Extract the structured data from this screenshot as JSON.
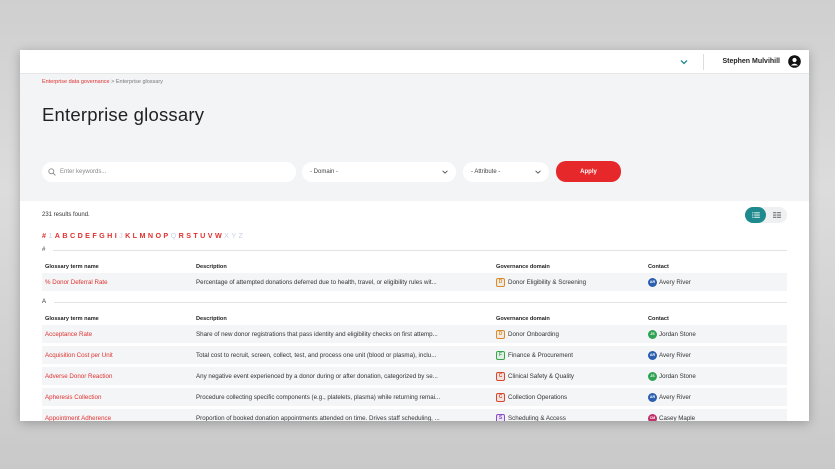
{
  "topbar": {
    "user_name": "Stephen Mulvihill"
  },
  "breadcrumb": {
    "parent": "Enterprise data governance",
    "separator": ">",
    "current": "Enterprise glossary"
  },
  "page_title": "Enterprise glossary",
  "filters": {
    "search_placeholder": "Enter keywords...",
    "domain_value": "- Domain -",
    "attribute_value": "- Attribute -",
    "apply_label": "Apply"
  },
  "results": {
    "count_text": "231 results found."
  },
  "alphabet": {
    "enabled": [
      "#",
      "A",
      "B",
      "C",
      "D",
      "E",
      "F",
      "G",
      "H",
      "I",
      "K",
      "L",
      "M",
      "N",
      "O",
      "P",
      "R",
      "S",
      "T",
      "U",
      "V",
      "W"
    ],
    "letters": [
      "#",
      "1",
      "A",
      "B",
      "C",
      "D",
      "E",
      "F",
      "G",
      "H",
      "I",
      "J",
      "K",
      "L",
      "M",
      "N",
      "O",
      "P",
      "Q",
      "R",
      "S",
      "T",
      "U",
      "V",
      "W",
      "X",
      "Y",
      "Z"
    ]
  },
  "columns": {
    "name": "Glossary term name",
    "description": "Description",
    "domain": "Governance domain",
    "contact": "Contact"
  },
  "sections": [
    {
      "letter": "#",
      "rows": [
        {
          "term": "% Donor Deferral Rate",
          "description": "Percentage of attempted donations deferred due to health, travel, or eligibility rules wit...",
          "domain_letter": "D",
          "domain": "Donor Eligibility & Screening",
          "domain_color": "#d98b2b",
          "contact_initials": "AR",
          "contact": "Avery River",
          "contact_color": "#2a5fb0"
        }
      ]
    },
    {
      "letter": "A",
      "rows": [
        {
          "term": "Acceptance Rate",
          "description": "Share of new donor registrations that pass identity and eligibility checks on first attemp...",
          "domain_letter": "D",
          "domain": "Donor Onboarding",
          "domain_color": "#d98b2b",
          "contact_initials": "JS",
          "contact": "Jordan Stone",
          "contact_color": "#2fa354"
        },
        {
          "term": "Acquisition Cost per Unit",
          "description": "Total cost to recruit, screen, collect, test, and process one unit (blood or plasma), inclu...",
          "domain_letter": "F",
          "domain": "Finance & Procurement",
          "domain_color": "#3aa64a",
          "contact_initials": "AR",
          "contact": "Avery River",
          "contact_color": "#2a5fb0"
        },
        {
          "term": "Adverse Donor Reaction",
          "description": "Any negative event experienced by a donor during or after donation, categorized by se...",
          "domain_letter": "C",
          "domain": "Clinical Safety & Quality",
          "domain_color": "#d9462b",
          "contact_initials": "JS",
          "contact": "Jordan Stone",
          "contact_color": "#2fa354"
        },
        {
          "term": "Apheresis Collection",
          "description": "Procedure collecting specific components (e.g., platelets, plasma) while returning remai...",
          "domain_letter": "C",
          "domain": "Collection Operations",
          "domain_color": "#d9462b",
          "contact_initials": "AR",
          "contact": "Avery River",
          "contact_color": "#2a5fb0"
        },
        {
          "term": "Appointment Adherence",
          "description": "Proportion of booked donation appointments attended on time. Drives staff scheduling, ...",
          "domain_letter": "S",
          "domain": "Scheduling & Access",
          "domain_color": "#8a4fc7",
          "contact_initials": "CM",
          "contact": "Casey Maple",
          "contact_color": "#c0306a"
        }
      ]
    }
  ]
}
